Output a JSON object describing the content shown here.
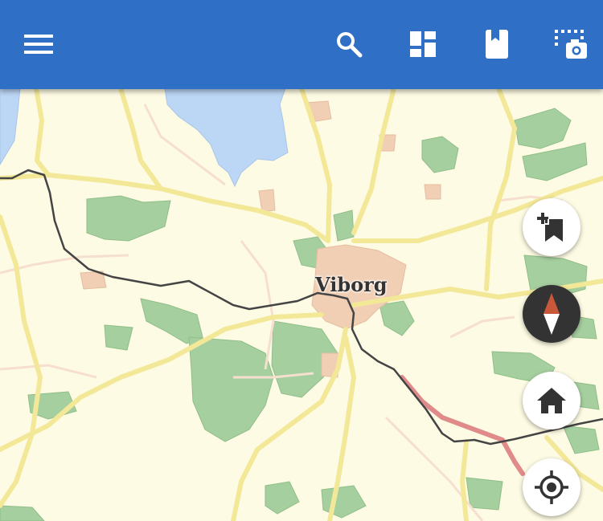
{
  "app_bar": {
    "color": "#2f6fc5",
    "icons": [
      "menu-icon",
      "search-icon",
      "dashboard-icon",
      "bookmark-icon",
      "screenshot-capture-icon"
    ]
  },
  "map": {
    "city_label": "Viborg",
    "colors": {
      "land": "#fdfbe3",
      "water": "#bcd6f5",
      "forest": "#a6cf9f",
      "road": "#f3e898",
      "urban": "#f1cfb4",
      "rail": "#444444",
      "route": "#e08a8a"
    }
  },
  "fab_buttons": {
    "icons": [
      "add-bookmark-icon",
      "compass-icon",
      "home-icon",
      "my-location-icon"
    ]
  }
}
